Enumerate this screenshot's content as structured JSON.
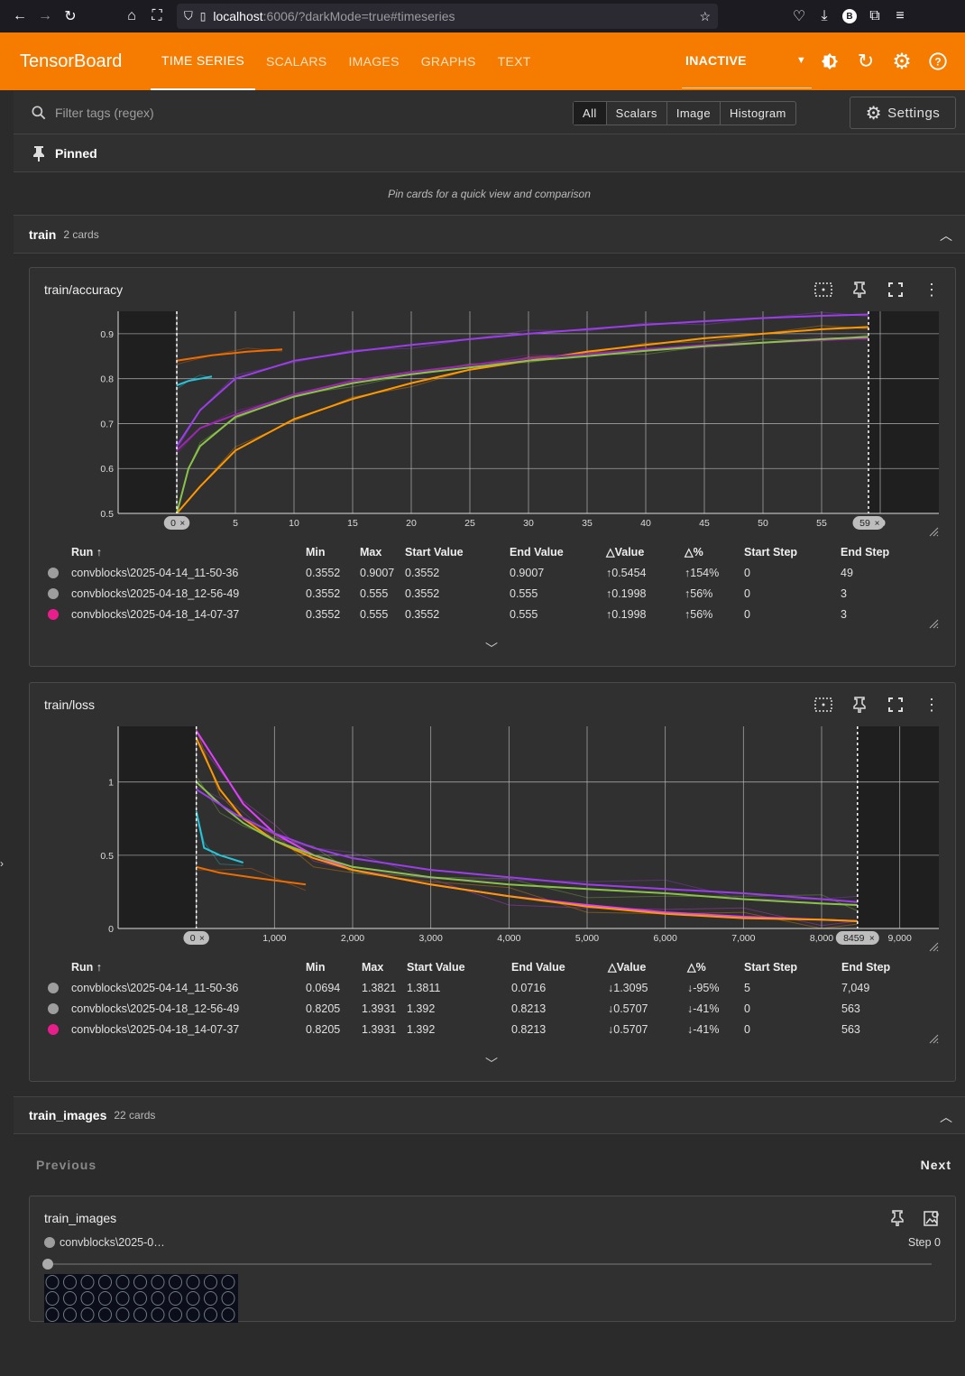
{
  "browser": {
    "url_host": "localhost",
    "url_rest": ":6006/?darkMode=true#timeseries",
    "profile_letter": "B"
  },
  "header": {
    "brand": "TensorBoard",
    "tabs": [
      "TIME SERIES",
      "SCALARS",
      "IMAGES",
      "GRAPHS",
      "TEXT"
    ],
    "active_tab": "TIME SERIES",
    "plugin_select": "INACTIVE"
  },
  "filter": {
    "placeholder": "Filter tags (regex)",
    "types": [
      "All",
      "Scalars",
      "Image",
      "Histogram"
    ],
    "settings_label": "Settings"
  },
  "pinned": {
    "title": "Pinned",
    "empty_message": "Pin cards for a quick view and comparison"
  },
  "groups": [
    {
      "name": "train",
      "count": "2 cards"
    },
    {
      "name": "train_images",
      "count": "22 cards"
    }
  ],
  "table_headers": [
    "Run ↑",
    "Min",
    "Max",
    "Start Value",
    "End Value",
    "△Value",
    "△%",
    "Start Step",
    "End Step"
  ],
  "cards": [
    {
      "title": "train/accuracy",
      "x_ticks": [
        "0",
        "5",
        "10",
        "15",
        "20",
        "25",
        "30",
        "35",
        "40",
        "45",
        "50",
        "55",
        "60"
      ],
      "y_ticks": [
        "0.9",
        "0.8",
        "0.7",
        "0.6",
        "0.5"
      ],
      "range_start": "0",
      "range_end": "59",
      "rows": [
        {
          "run": "convblocks\\2025-04-14_11-50-36",
          "min": "0.3552",
          "max": "0.9007",
          "start": "0.3552",
          "end": "0.9007",
          "dvalue": "↑0.5454",
          "dpct": "↑154%",
          "start_step": "0",
          "end_step": "49",
          "color": "#9e9e9e"
        },
        {
          "run": "convblocks\\2025-04-18_12-56-49",
          "min": "0.3552",
          "max": "0.555",
          "start": "0.3552",
          "end": "0.555",
          "dvalue": "↑0.1998",
          "dpct": "↑56%",
          "start_step": "0",
          "end_step": "3",
          "color": "#9e9e9e"
        },
        {
          "run": "convblocks\\2025-04-18_14-07-37",
          "min": "0.3552",
          "max": "0.555",
          "start": "0.3552",
          "end": "0.555",
          "dvalue": "↑0.1998",
          "dpct": "↑56%",
          "start_step": "0",
          "end_step": "3",
          "color": "#e91e8c"
        }
      ]
    },
    {
      "title": "train/loss",
      "x_ticks": [
        "0",
        "1,000",
        "2,000",
        "3,000",
        "4,000",
        "5,000",
        "6,000",
        "7,000",
        "8,000",
        "9,000"
      ],
      "y_ticks": [
        "1",
        "0.5",
        "0"
      ],
      "range_start": "0",
      "range_end": "8459",
      "rows": [
        {
          "run": "convblocks\\2025-04-14_11-50-36",
          "min": "0.0694",
          "max": "1.3821",
          "start": "1.3811",
          "end": "0.0716",
          "dvalue": "↓1.3095",
          "dpct": "↓-95%",
          "start_step": "5",
          "end_step": "7,049",
          "color": "#9e9e9e"
        },
        {
          "run": "convblocks\\2025-04-18_12-56-49",
          "min": "0.8205",
          "max": "1.3931",
          "start": "1.392",
          "end": "0.8213",
          "dvalue": "↓0.5707",
          "dpct": "↓-41%",
          "start_step": "0",
          "end_step": "563",
          "color": "#9e9e9e"
        },
        {
          "run": "convblocks\\2025-04-18_14-07-37",
          "min": "0.8205",
          "max": "1.3931",
          "start": "1.392",
          "end": "0.8213",
          "dvalue": "↓0.5707",
          "dpct": "↓-41%",
          "start_step": "0",
          "end_step": "563",
          "color": "#e91e8c"
        }
      ]
    }
  ],
  "images_nav": {
    "prev": "Previous",
    "next": "Next"
  },
  "image_card": {
    "title": "train_images",
    "run": "convblocks\\2025-0…",
    "step": "Step 0"
  },
  "chart_data": [
    {
      "type": "line",
      "title": "train/accuracy",
      "xlabel": "",
      "ylabel": "",
      "xlim": [
        -5,
        65
      ],
      "ylim": [
        0.5,
        0.95
      ],
      "series": [
        {
          "color": "#ff9800",
          "x": [
            0,
            2,
            5,
            10,
            15,
            20,
            25,
            30,
            35,
            40,
            45,
            50,
            55,
            59
          ],
          "y": [
            0.48,
            0.56,
            0.64,
            0.71,
            0.755,
            0.79,
            0.82,
            0.84,
            0.86,
            0.875,
            0.89,
            0.9,
            0.91,
            0.915
          ]
        },
        {
          "color": "#9c27b0",
          "x": [
            0,
            2,
            5,
            10,
            15,
            20,
            25,
            30,
            35,
            40,
            45,
            50,
            55,
            59
          ],
          "y": [
            0.64,
            0.69,
            0.72,
            0.765,
            0.795,
            0.815,
            0.83,
            0.845,
            0.855,
            0.865,
            0.875,
            0.88,
            0.886,
            0.89
          ]
        },
        {
          "color": "#8bc34a",
          "x": [
            0,
            1,
            2,
            5,
            10,
            15,
            20,
            25,
            30,
            35,
            40,
            45,
            50,
            55,
            59
          ],
          "y": [
            0.5,
            0.6,
            0.65,
            0.715,
            0.76,
            0.79,
            0.81,
            0.825,
            0.84,
            0.85,
            0.862,
            0.872,
            0.88,
            0.888,
            0.893
          ]
        },
        {
          "color": "#9c3ee8",
          "x": [
            0,
            2,
            5,
            10,
            15,
            20,
            25,
            30,
            35,
            40,
            45,
            50,
            55,
            59
          ],
          "y": [
            0.65,
            0.73,
            0.8,
            0.84,
            0.86,
            0.875,
            0.888,
            0.9,
            0.91,
            0.92,
            0.928,
            0.935,
            0.94,
            0.943
          ]
        },
        {
          "color": "#ef6c00",
          "x": [
            0,
            3,
            6,
            9
          ],
          "y": [
            0.84,
            0.852,
            0.86,
            0.865
          ]
        },
        {
          "color": "#26c6da",
          "x": [
            0,
            1,
            2,
            3
          ],
          "y": [
            0.785,
            0.795,
            0.8,
            0.805
          ]
        }
      ]
    },
    {
      "type": "line",
      "title": "train/loss",
      "xlabel": "",
      "ylabel": "",
      "xlim": [
        -1000,
        9500
      ],
      "ylim": [
        0,
        1.38
      ],
      "series": [
        {
          "color": "#e040fb",
          "x": [
            0,
            300,
            600,
            1000,
            1500,
            2000,
            3000,
            4000,
            5000,
            6000,
            7000,
            8000,
            8459
          ],
          "y": [
            1.35,
            1.1,
            0.85,
            0.65,
            0.5,
            0.4,
            0.3,
            0.22,
            0.16,
            0.11,
            0.08,
            0.06,
            0.05
          ]
        },
        {
          "color": "#ff9800",
          "x": [
            0,
            300,
            600,
            1000,
            1500,
            2000,
            3000,
            4000,
            5000,
            6000,
            7000,
            8000,
            8459
          ],
          "y": [
            1.3,
            0.95,
            0.75,
            0.6,
            0.48,
            0.4,
            0.3,
            0.22,
            0.15,
            0.1,
            0.07,
            0.06,
            0.05
          ]
        },
        {
          "color": "#8bc34a",
          "x": [
            0,
            300,
            600,
            1000,
            1500,
            2000,
            3000,
            4000,
            5000,
            6000,
            7000,
            8000,
            8459
          ],
          "y": [
            1.0,
            0.85,
            0.72,
            0.6,
            0.5,
            0.42,
            0.35,
            0.3,
            0.27,
            0.24,
            0.2,
            0.17,
            0.16
          ]
        },
        {
          "color": "#9c3ee8",
          "x": [
            0,
            500,
            1000,
            1500,
            2000,
            3000,
            4000,
            5000,
            6000,
            7000,
            8000,
            8459
          ],
          "y": [
            0.95,
            0.78,
            0.65,
            0.55,
            0.48,
            0.4,
            0.35,
            0.3,
            0.27,
            0.24,
            0.2,
            0.18
          ]
        },
        {
          "color": "#26c6da",
          "x": [
            0,
            100,
            300,
            600
          ],
          "y": [
            0.8,
            0.55,
            0.5,
            0.45
          ]
        },
        {
          "color": "#ef6c00",
          "x": [
            0,
            300,
            700,
            1400
          ],
          "y": [
            0.42,
            0.38,
            0.35,
            0.3
          ]
        }
      ]
    }
  ]
}
